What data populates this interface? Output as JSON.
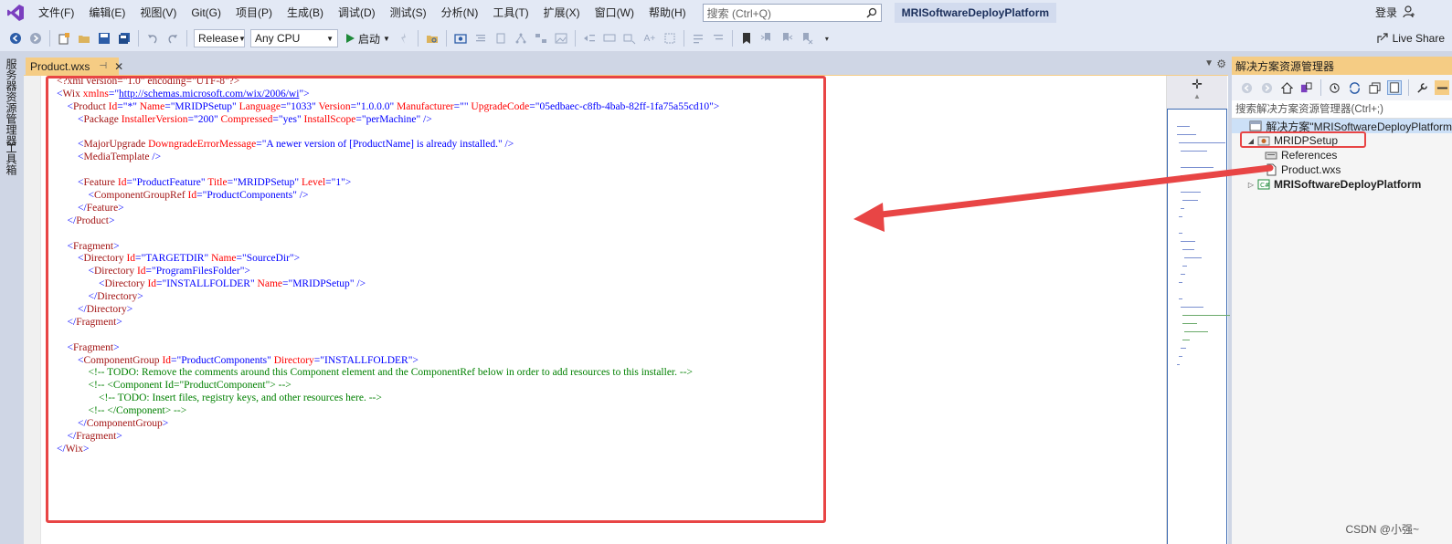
{
  "menu": {
    "items": [
      "文件(F)",
      "编辑(E)",
      "视图(V)",
      "Git(G)",
      "项目(P)",
      "生成(B)",
      "调试(D)",
      "测试(S)",
      "分析(N)",
      "工具(T)",
      "扩展(X)",
      "窗口(W)",
      "帮助(H)"
    ],
    "search_placeholder": "搜索 (Ctrl+Q)",
    "solution_title": "MRISoftwareDeployPlatform",
    "login": "登录"
  },
  "toolbar": {
    "configuration": "Release",
    "platform": "Any CPU",
    "start_label": "启动",
    "live_share": "Live Share"
  },
  "left_strip": {
    "server_explorer": "服务器资源管理器",
    "toolbox": "工具箱"
  },
  "editor": {
    "tab_title": "Product.wxs",
    "lines": [
      [
        [
          "t-br",
          "<?xml version=\"1.0\" encoding=\"UTF-8\"?>"
        ]
      ],
      [
        [
          "t-punct",
          "<"
        ],
        [
          "t-tag",
          "Wix"
        ],
        [
          "t-attr",
          " xmlns"
        ],
        [
          "t-punct",
          "=\""
        ],
        [
          "t-link",
          "http://schemas.microsoft.com/wix/2006/wi"
        ],
        [
          "t-punct",
          "\">"
        ]
      ],
      [
        [
          "t-punct",
          "    <"
        ],
        [
          "t-tag",
          "Product"
        ],
        [
          "t-attr",
          " Id"
        ],
        [
          "t-punct",
          "=\""
        ],
        [
          "t-val",
          "*"
        ],
        [
          "t-punct",
          "\""
        ],
        [
          "t-attr",
          " Name"
        ],
        [
          "t-punct",
          "=\""
        ],
        [
          "t-val",
          "MRIDPSetup"
        ],
        [
          "t-punct",
          "\""
        ],
        [
          "t-attr",
          " Language"
        ],
        [
          "t-punct",
          "=\""
        ],
        [
          "t-val",
          "1033"
        ],
        [
          "t-punct",
          "\""
        ],
        [
          "t-attr",
          " Version"
        ],
        [
          "t-punct",
          "=\""
        ],
        [
          "t-val",
          "1.0.0.0"
        ],
        [
          "t-punct",
          "\""
        ],
        [
          "t-attr",
          " Manufacturer"
        ],
        [
          "t-punct",
          "=\"\""
        ],
        [
          "t-attr",
          " UpgradeCode"
        ],
        [
          "t-punct",
          "=\""
        ],
        [
          "t-val",
          "05edbaec-c8fb-4bab-82ff-1fa75a55cd10"
        ],
        [
          "t-punct",
          "\">"
        ]
      ],
      [
        [
          "t-punct",
          "        <"
        ],
        [
          "t-tag",
          "Package"
        ],
        [
          "t-attr",
          " InstallerVersion"
        ],
        [
          "t-punct",
          "=\""
        ],
        [
          "t-val",
          "200"
        ],
        [
          "t-punct",
          "\""
        ],
        [
          "t-attr",
          " Compressed"
        ],
        [
          "t-punct",
          "=\""
        ],
        [
          "t-val",
          "yes"
        ],
        [
          "t-punct",
          "\""
        ],
        [
          "t-attr",
          " InstallScope"
        ],
        [
          "t-punct",
          "=\""
        ],
        [
          "t-val",
          "perMachine"
        ],
        [
          "t-punct",
          "\" />"
        ]
      ],
      [],
      [
        [
          "t-punct",
          "        <"
        ],
        [
          "t-tag",
          "MajorUpgrade"
        ],
        [
          "t-attr",
          " DowngradeErrorMessage"
        ],
        [
          "t-punct",
          "=\""
        ],
        [
          "t-val",
          "A newer version of [ProductName] is already installed."
        ],
        [
          "t-punct",
          "\" />"
        ]
      ],
      [
        [
          "t-punct",
          "        <"
        ],
        [
          "t-tag",
          "MediaTemplate"
        ],
        [
          "t-punct",
          " />"
        ]
      ],
      [],
      [
        [
          "t-punct",
          "        <"
        ],
        [
          "t-tag",
          "Feature"
        ],
        [
          "t-attr",
          " Id"
        ],
        [
          "t-punct",
          "=\""
        ],
        [
          "t-val",
          "ProductFeature"
        ],
        [
          "t-punct",
          "\""
        ],
        [
          "t-attr",
          " Title"
        ],
        [
          "t-punct",
          "=\""
        ],
        [
          "t-val",
          "MRIDPSetup"
        ],
        [
          "t-punct",
          "\""
        ],
        [
          "t-attr",
          " Level"
        ],
        [
          "t-punct",
          "=\""
        ],
        [
          "t-val",
          "1"
        ],
        [
          "t-punct",
          "\">"
        ]
      ],
      [
        [
          "t-punct",
          "            <"
        ],
        [
          "t-tag",
          "ComponentGroupRef"
        ],
        [
          "t-attr",
          " Id"
        ],
        [
          "t-punct",
          "=\""
        ],
        [
          "t-val",
          "ProductComponents"
        ],
        [
          "t-punct",
          "\" />"
        ]
      ],
      [
        [
          "t-punct",
          "        </"
        ],
        [
          "t-tag",
          "Feature"
        ],
        [
          "t-punct",
          ">"
        ]
      ],
      [
        [
          "t-punct",
          "    </"
        ],
        [
          "t-tag",
          "Product"
        ],
        [
          "t-punct",
          ">"
        ]
      ],
      [],
      [
        [
          "t-punct",
          "    <"
        ],
        [
          "t-tag",
          "Fragment"
        ],
        [
          "t-punct",
          ">"
        ]
      ],
      [
        [
          "t-punct",
          "        <"
        ],
        [
          "t-tag",
          "Directory"
        ],
        [
          "t-attr",
          " Id"
        ],
        [
          "t-punct",
          "=\""
        ],
        [
          "t-val",
          "TARGETDIR"
        ],
        [
          "t-punct",
          "\""
        ],
        [
          "t-attr",
          " Name"
        ],
        [
          "t-punct",
          "=\""
        ],
        [
          "t-val",
          "SourceDir"
        ],
        [
          "t-punct",
          "\">"
        ]
      ],
      [
        [
          "t-punct",
          "            <"
        ],
        [
          "t-tag",
          "Directory"
        ],
        [
          "t-attr",
          " Id"
        ],
        [
          "t-punct",
          "=\""
        ],
        [
          "t-val",
          "ProgramFilesFolder"
        ],
        [
          "t-punct",
          "\">"
        ]
      ],
      [
        [
          "t-punct",
          "                <"
        ],
        [
          "t-tag",
          "Directory"
        ],
        [
          "t-attr",
          " Id"
        ],
        [
          "t-punct",
          "=\""
        ],
        [
          "t-val",
          "INSTALLFOLDER"
        ],
        [
          "t-punct",
          "\""
        ],
        [
          "t-attr",
          " Name"
        ],
        [
          "t-punct",
          "=\""
        ],
        [
          "t-val",
          "MRIDPSetup"
        ],
        [
          "t-punct",
          "\" />"
        ]
      ],
      [
        [
          "t-punct",
          "            </"
        ],
        [
          "t-tag",
          "Directory"
        ],
        [
          "t-punct",
          ">"
        ]
      ],
      [
        [
          "t-punct",
          "        </"
        ],
        [
          "t-tag",
          "Directory"
        ],
        [
          "t-punct",
          ">"
        ]
      ],
      [
        [
          "t-punct",
          "    </"
        ],
        [
          "t-tag",
          "Fragment"
        ],
        [
          "t-punct",
          ">"
        ]
      ],
      [],
      [
        [
          "t-punct",
          "    <"
        ],
        [
          "t-tag",
          "Fragment"
        ],
        [
          "t-punct",
          ">"
        ]
      ],
      [
        [
          "t-punct",
          "        <"
        ],
        [
          "t-tag",
          "ComponentGroup"
        ],
        [
          "t-attr",
          " Id"
        ],
        [
          "t-punct",
          "=\""
        ],
        [
          "t-val",
          "ProductComponents"
        ],
        [
          "t-punct",
          "\""
        ],
        [
          "t-attr",
          " Directory"
        ],
        [
          "t-punct",
          "=\""
        ],
        [
          "t-val",
          "INSTALLFOLDER"
        ],
        [
          "t-punct",
          "\">"
        ]
      ],
      [
        [
          "t-com",
          "            <!-- TODO: Remove the comments around this Component element and the ComponentRef below in order to add resources to this installer. -->"
        ]
      ],
      [
        [
          "t-com",
          "            <!-- <Component Id=\"ProductComponent\"> -->"
        ]
      ],
      [
        [
          "t-com",
          "                <!-- TODO: Insert files, registry keys, and other resources here. -->"
        ]
      ],
      [
        [
          "t-com",
          "            <!-- </Component> -->"
        ]
      ],
      [
        [
          "t-punct",
          "        </"
        ],
        [
          "t-tag",
          "ComponentGroup"
        ],
        [
          "t-punct",
          ">"
        ]
      ],
      [
        [
          "t-punct",
          "    </"
        ],
        [
          "t-tag",
          "Fragment"
        ],
        [
          "t-punct",
          ">"
        ]
      ],
      [
        [
          "t-punct",
          "</"
        ],
        [
          "t-tag",
          "Wix"
        ],
        [
          "t-punct",
          ">"
        ]
      ]
    ]
  },
  "solution_explorer": {
    "title": "解决方案资源管理器",
    "search_placeholder": "搜索解决方案资源管理器(Ctrl+;)",
    "items": [
      {
        "label": "解决方案\"MRISoftwareDeployPlatform",
        "level": 0,
        "expander": "",
        "icon": "solution-icon"
      },
      {
        "label": "MRIDPSetup",
        "level": 1,
        "expander": "◢",
        "icon": "wix-project-icon"
      },
      {
        "label": "References",
        "level": 2,
        "expander": "",
        "icon": "references-icon"
      },
      {
        "label": "Product.wxs",
        "level": 2,
        "expander": "",
        "icon": "file-icon"
      },
      {
        "label": "MRISoftwareDeployPlatform",
        "level": 1,
        "expander": "▷",
        "icon": "csharp-project-icon",
        "bold": true
      }
    ]
  },
  "watermark": "CSDN @小强~",
  "colors": {
    "accent_tab": "#f5cc84",
    "annotation_red": "#e84545",
    "menu_bg": "#e3e9f5"
  }
}
